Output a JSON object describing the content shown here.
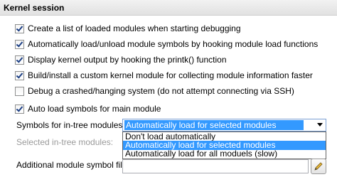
{
  "section": {
    "title": "Kernel session"
  },
  "options": [
    {
      "label": "Create a list of loaded modules when starting debugging",
      "checked": true
    },
    {
      "label": "Automatically load/unload module symbols by hooking module load functions",
      "checked": true
    },
    {
      "label": "Display kernel output by hooking the printk() function",
      "checked": true
    },
    {
      "label": "Build/install a custom kernel module for collecting module information faster",
      "checked": true
    },
    {
      "label": "Debug a crashed/hanging system (do not attempt connecting via SSH)",
      "checked": false
    },
    {
      "label": "Auto load symbols for main module",
      "checked": true
    }
  ],
  "symbols": {
    "label": "Symbols for in-tree modules:",
    "selected": "Automatically load for selected modules",
    "options": [
      "Don't load automatically",
      "Automatically load for selected modules",
      "Automatically load for all moduels (slow)"
    ]
  },
  "selected_modules": {
    "label": "Selected in-tree modules:"
  },
  "additional": {
    "label": "Additional module symbol files:",
    "value": ""
  },
  "colors": {
    "selection": "#3399ff",
    "disabled_text": "#9a9a9a"
  }
}
